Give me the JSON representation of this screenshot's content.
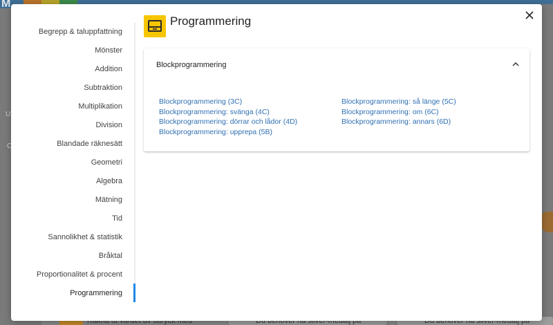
{
  "background": {
    "left_labels": [
      "U",
      "C"
    ],
    "bottom_texts": [
      "Räkna ut värdet av uttryck med",
      "Du behöver ha silver-medalj på",
      "Du behöver ha silver-medalj på"
    ]
  },
  "modal": {
    "title": "Programmering",
    "title_icon": "laptop-icon",
    "close_icon": "close-icon",
    "accent_color": "#1e88e5",
    "icon_color": "#f7c600",
    "link_color": "#2f6fb3"
  },
  "sidebar": {
    "items": [
      {
        "label": "Begrepp & taluppfattning"
      },
      {
        "label": "Mönster"
      },
      {
        "label": "Addition"
      },
      {
        "label": "Subtraktion"
      },
      {
        "label": "Multiplikation"
      },
      {
        "label": "Division"
      },
      {
        "label": "Blandade räknesätt"
      },
      {
        "label": "Geometri"
      },
      {
        "label": "Algebra"
      },
      {
        "label": "Mätning"
      },
      {
        "label": "Tid"
      },
      {
        "label": "Sannolikhet & statistik"
      },
      {
        "label": "Bråktal"
      },
      {
        "label": "Proportionalitet & procent"
      },
      {
        "label": "Programmering"
      }
    ],
    "active_index": 14
  },
  "section": {
    "header": "Blockprogrammering",
    "expanded": true,
    "toggle_icon": "chevron-up-icon",
    "links_col1": [
      "Blockprogrammering (3C)",
      "Blockprogrammering: svänga (4C)",
      "Blockprogrammering: dörrar och lådor (4D)",
      "Blockprogrammering: upprepa (5B)"
    ],
    "links_col2": [
      "Blockprogrammering: så länge (5C)",
      "Blockprogrammering: om (6C)",
      "Blockprogrammering: annars (6D)"
    ]
  }
}
